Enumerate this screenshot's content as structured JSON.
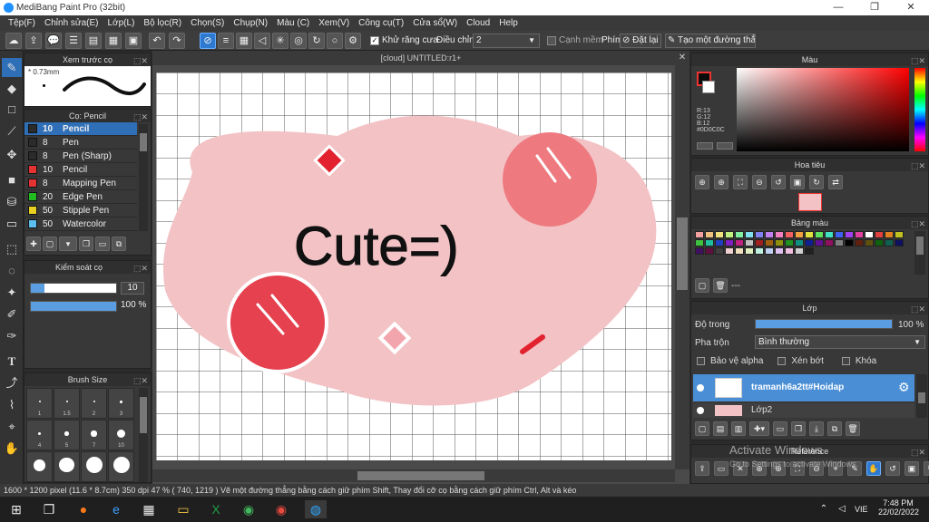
{
  "window": {
    "title": "MediBang Paint Pro (32bit)",
    "minimize": "—",
    "maximize": "❐",
    "close": "✕"
  },
  "menu": [
    "Tệp(F)",
    "Chỉnh sửa(E)",
    "Lớp(L)",
    "Bộ lọc(R)",
    "Chọn(S)",
    "Chụp(N)",
    "Màu (C)",
    "Xem(V)",
    "Công cụ(T)",
    "Cửa sổ(W)",
    "Cloud",
    "Help"
  ],
  "toolbar": {
    "antialias_label": "Khử răng cưa",
    "adjust_label": "Điều chỉnh",
    "adjust_value": "2",
    "smooth_label": "Cạnh mềm",
    "key_label": "Phím",
    "reset_label": "Đặt lại",
    "straight_label": "Tạo một đường thẳng"
  },
  "brush_preview": {
    "title": "Xem trước cọ",
    "size": "* 0.73mm"
  },
  "brush_list": {
    "title": "Cọ: Pencil",
    "items": [
      {
        "size": "10",
        "name": "Pencil",
        "color": "#2b2b2b",
        "selected": true
      },
      {
        "size": "8",
        "name": "Pen",
        "color": "#2b2b2b"
      },
      {
        "size": "8",
        "name": "Pen (Sharp)",
        "color": "#2b2b2b"
      },
      {
        "size": "10",
        "name": "Pencil",
        "color": "#e53333"
      },
      {
        "size": "8",
        "name": "Mapping Pen",
        "color": "#e53333"
      },
      {
        "size": "20",
        "name": "Edge Pen",
        "color": "#22bb22"
      },
      {
        "size": "50",
        "name": "Stipple Pen",
        "color": "#e8d020"
      },
      {
        "size": "50",
        "name": "Watercolor",
        "color": "#5bc0f0"
      }
    ]
  },
  "brush_control": {
    "title": "Kiểm soát cọ",
    "size_value": "10",
    "size_fraction": 0.16,
    "opacity_value": "100 %",
    "opacity_fraction": 1.0
  },
  "brush_size": {
    "title": "Brush Size",
    "labels": [
      "1",
      "1.5",
      "2",
      "3",
      "4",
      "5",
      "7",
      "10"
    ]
  },
  "canvas": {
    "tab": "[cloud] UNTITLED:r1+",
    "text": "Cute=)"
  },
  "color": {
    "title": "Màu",
    "r": "R:13",
    "g": "G:12",
    "b": "B:12",
    "hex": "#0D0C0C",
    "primary": "#0d0c0c"
  },
  "navigator": {
    "title": "Hoa tiêu"
  },
  "palette": {
    "title": "Bảng màu",
    "empty": "---"
  },
  "layer": {
    "title": "Lớp",
    "opacity_label": "Độ trong",
    "opacity_value": "100 %",
    "opacity_fraction": 1.0,
    "blend_label": "Pha trộn",
    "blend_value": "Bình thường",
    "protect_alpha": "Bảo vệ alpha",
    "clip": "Xén bớt",
    "lock": "Khóa",
    "layers": [
      "tramanh6a2tt#Hoidap",
      "Lớp2"
    ]
  },
  "reference": {
    "title": "Reference"
  },
  "watermark": {
    "line1": "Activate Windows",
    "line2": "Go to Settings to activate Windows."
  },
  "status": "1600 * 1200 pixel  (11.6 * 8.7cm)  350 dpi  47 %  ( 740, 1219 )  Vẽ một đường thẳng bằng cách giữ phím Shift, Thay đổi cỡ cọ bằng cách giữ phím Ctrl, Alt và kéo",
  "taskbar": {
    "lang": "VIE",
    "time": "7:48 PM",
    "date": "22/02/2022"
  }
}
